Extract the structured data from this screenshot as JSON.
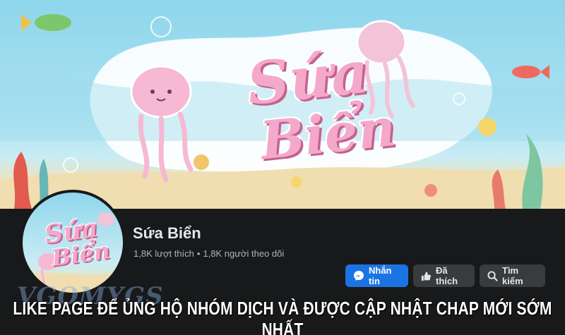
{
  "cover": {
    "title_line1": "Sứa",
    "title_line2": "Biển"
  },
  "avatar": {
    "title_line1": "Sứa",
    "title_line2": "Biển"
  },
  "page": {
    "name": "Sứa Biển",
    "likes": "1,8K lượt thích",
    "separator": "•",
    "followers": "1,8K người theo dõi"
  },
  "actions": {
    "message_label": "Nhắn tin",
    "liked_label": "Đã thích",
    "search_label": "Tìm kiếm"
  },
  "caption": "LIKE PAGE ĐỂ ỦNG HỘ NHÓM DỊCH VÀ ĐƯỢC CẬP NHẬT CHAP MỚI SỚM NHẤT",
  "watermark": "VGOMYGS",
  "colors": {
    "background": "#18191a",
    "primary_button": "#1b74e4",
    "secondary_button": "#3a3b3c",
    "title_pink": "#f4a9cb"
  },
  "icons": [
    "messenger-icon",
    "thumbs-up-icon",
    "search-icon"
  ]
}
